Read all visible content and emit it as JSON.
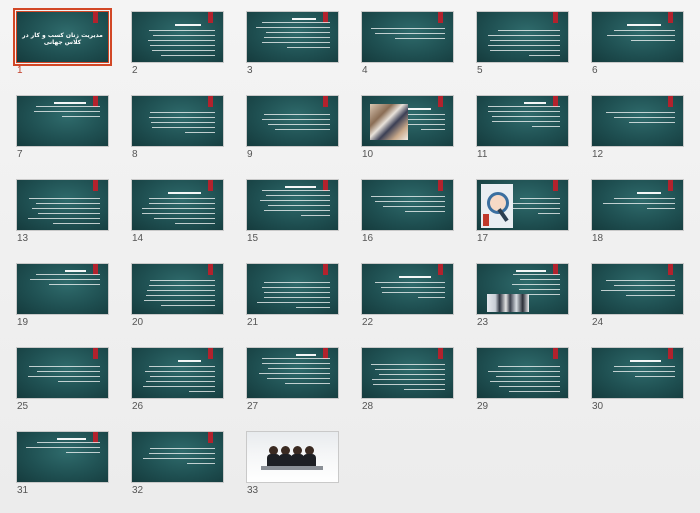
{
  "slides": [
    {
      "number": "1",
      "title": "مدیریت زنان کسب و کار در کلاس جهانی",
      "selected": true
    },
    {
      "number": "2"
    },
    {
      "number": "3"
    },
    {
      "number": "4"
    },
    {
      "number": "5"
    },
    {
      "number": "6"
    },
    {
      "number": "7"
    },
    {
      "number": "8"
    },
    {
      "number": "9"
    },
    {
      "number": "10",
      "image": "business-meeting"
    },
    {
      "number": "11"
    },
    {
      "number": "12"
    },
    {
      "number": "13"
    },
    {
      "number": "14"
    },
    {
      "number": "15"
    },
    {
      "number": "16"
    },
    {
      "number": "17",
      "image": "magnifier-people"
    },
    {
      "number": "18"
    },
    {
      "number": "19"
    },
    {
      "number": "20"
    },
    {
      "number": "21"
    },
    {
      "number": "22"
    },
    {
      "number": "23",
      "image": "business-team"
    },
    {
      "number": "24"
    },
    {
      "number": "25"
    },
    {
      "number": "26"
    },
    {
      "number": "27"
    },
    {
      "number": "28"
    },
    {
      "number": "29"
    },
    {
      "number": "30"
    },
    {
      "number": "31"
    },
    {
      "number": "32"
    },
    {
      "number": "33",
      "image": "women-panel"
    }
  ],
  "colors": {
    "slide_bg": "#1f5052",
    "accent_ribbon": "#b3222d",
    "selection": "#d24726"
  }
}
